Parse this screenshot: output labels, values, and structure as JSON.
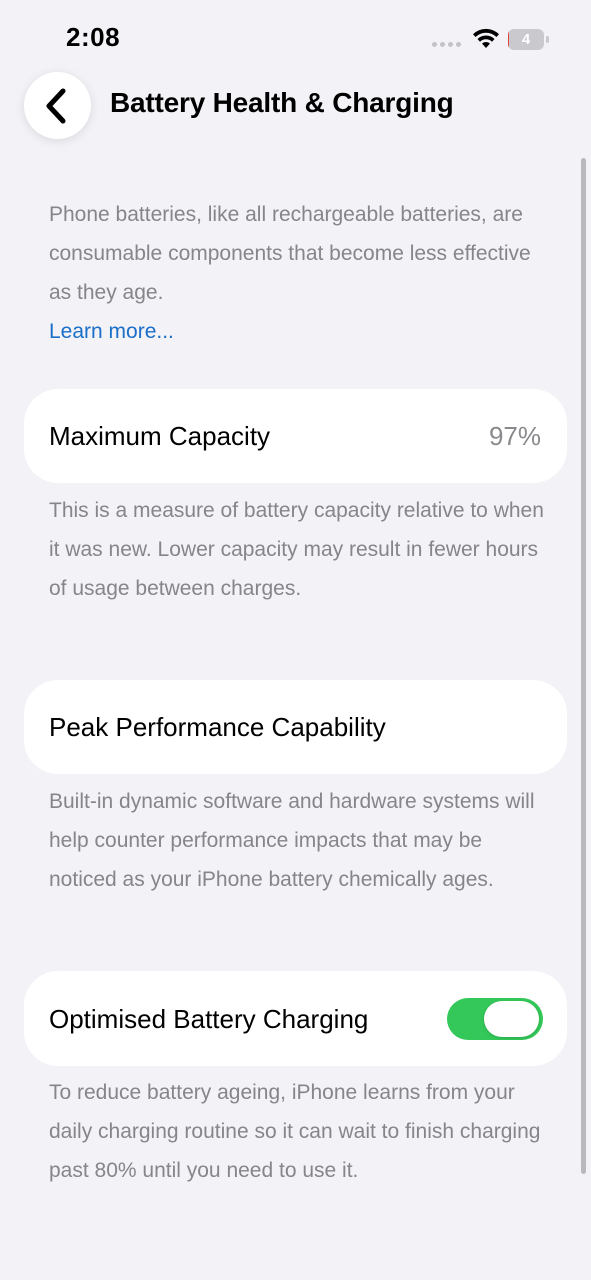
{
  "status_bar": {
    "time": "2:08",
    "battery_level": "4",
    "battery_color": "#e1413b",
    "battery_fraction": 0.04,
    "icons": [
      "signal-dots-icon",
      "wifi-icon",
      "battery-icon"
    ]
  },
  "header": {
    "back_icon": "chevron-left-icon",
    "title": "Battery Health & Charging"
  },
  "intro": {
    "text": "Phone batteries, like all rechargeable batteries, are consumable components that become less effective as they age.",
    "link_label": "Learn more...",
    "link_color": "#1b6fc8"
  },
  "max_capacity": {
    "label": "Maximum Capacity",
    "value": "97%",
    "description": "This is a measure of battery capacity relative to when it was new. Lower capacity may result in fewer hours of usage between charges."
  },
  "peak_performance": {
    "label": "Peak Performance Capability",
    "description": "Built-in dynamic software and hardware systems will help counter performance impacts that may be noticed as your iPhone battery chemically ages."
  },
  "optimised_charging": {
    "label": "Optimised Battery Charging",
    "enabled": true,
    "toggle_color": "#34c759",
    "description": "To reduce battery ageing, iPhone learns from your daily charging routine so it can wait to finish charging past 80% until you need to use it."
  }
}
